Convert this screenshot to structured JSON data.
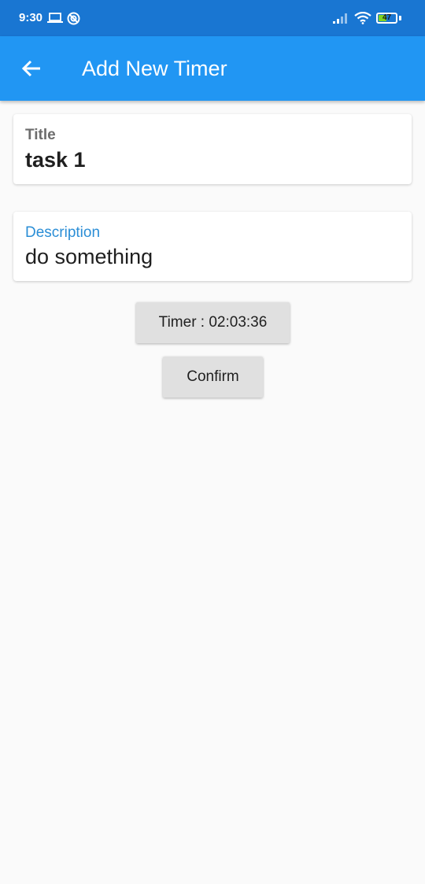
{
  "status_bar": {
    "time": "9:30",
    "battery_level": "47",
    "battery_fraction": 0.47,
    "icons": [
      "laptop-icon",
      "sync-icon",
      "signal-icon",
      "wifi-icon",
      "battery-icon"
    ]
  },
  "app_bar": {
    "title": "Add New Timer",
    "back_icon": "arrow-back-icon",
    "color": "#2196f3"
  },
  "form": {
    "title": {
      "label": "Title",
      "value": "task 1"
    },
    "description": {
      "label": "Description",
      "value": "do something",
      "label_color": "#2b8ed6"
    }
  },
  "actions": {
    "timer_label": "Timer : 02:03:36",
    "confirm_label": "Confirm"
  }
}
